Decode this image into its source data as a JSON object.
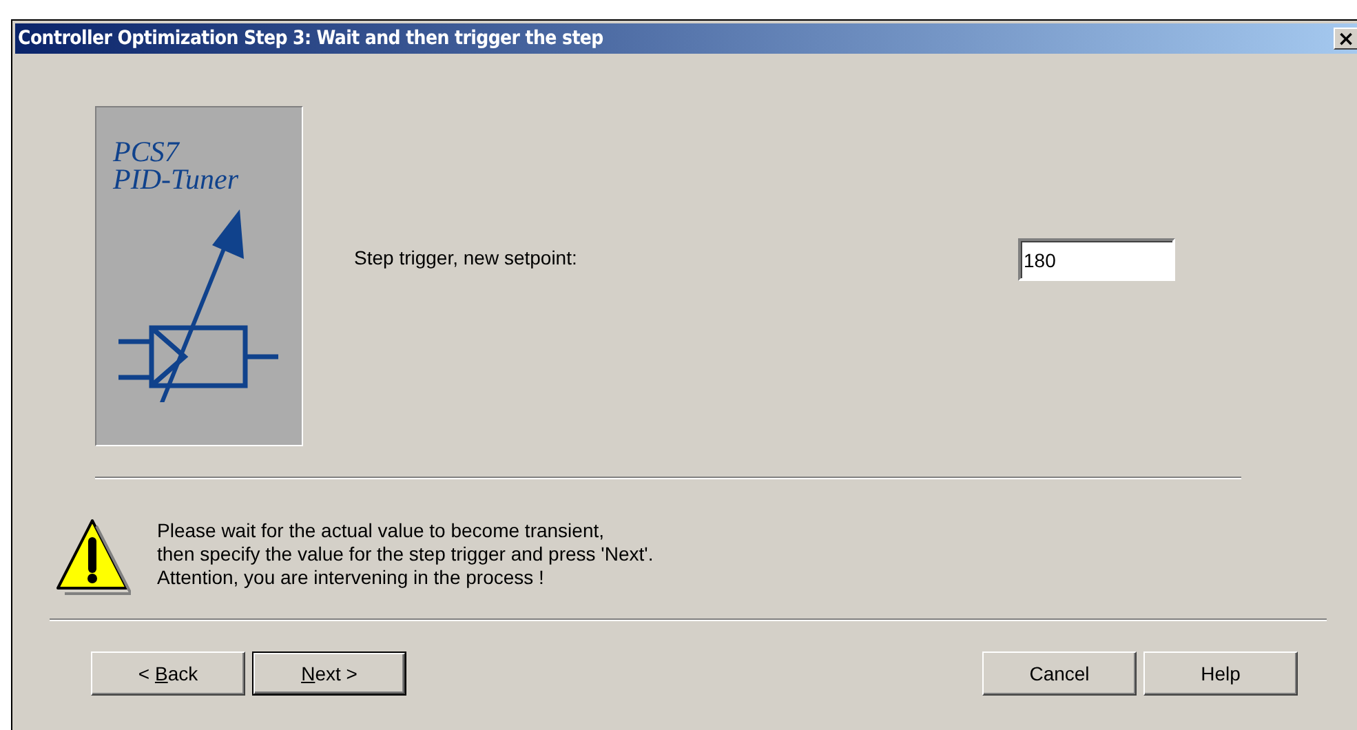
{
  "window": {
    "title": "Controller Optimization Step 3: Wait and then trigger the step",
    "close": "×"
  },
  "logo": {
    "lines": [
      "PCS7",
      "PID-Tuner"
    ]
  },
  "setpoint": {
    "label": "Step trigger, new setpoint:",
    "value": "180"
  },
  "warning": {
    "lines": [
      "Please wait for the actual value to become transient,",
      "then specify the value for the step trigger and press 'Next'.",
      "Attention, you are intervening in the process !"
    ]
  },
  "buttons_left": [
    {
      "parts": [
        {
          "text": "< ",
          "underlined": false
        },
        {
          "text": "B",
          "underlined": true
        },
        {
          "text": "ack",
          "underlined": false
        }
      ],
      "default": false
    },
    {
      "parts": [
        {
          "text": "N",
          "underlined": true
        },
        {
          "text": "ext >",
          "underlined": false
        }
      ],
      "default": true
    }
  ],
  "buttons_right": [
    {
      "parts": [
        {
          "text": "Cancel",
          "underlined": false
        }
      ],
      "default": false
    },
    {
      "parts": [
        {
          "text": "Help",
          "underlined": false
        }
      ],
      "default": false
    }
  ]
}
